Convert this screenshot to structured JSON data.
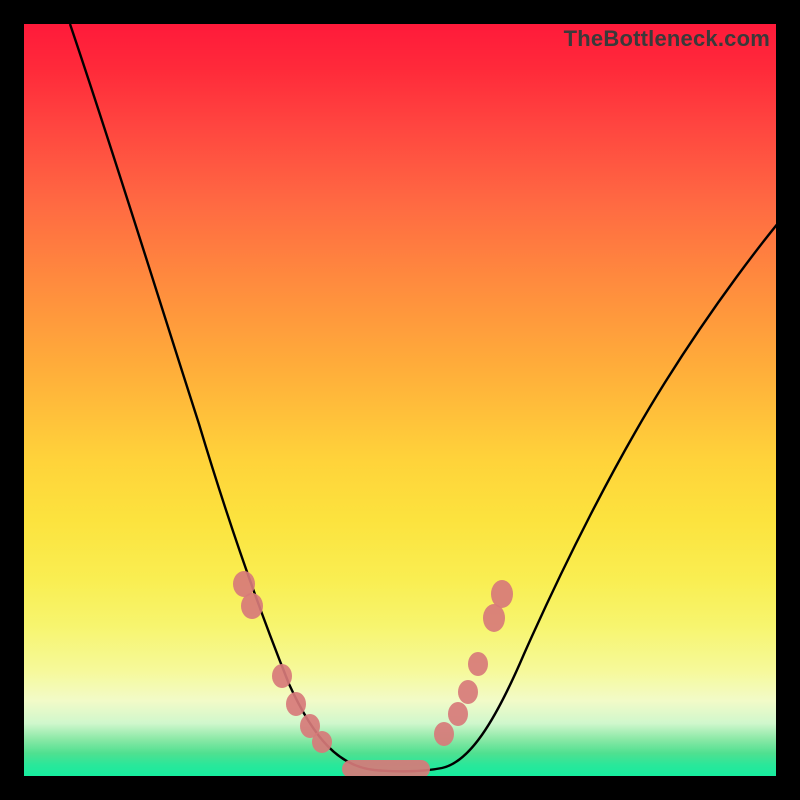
{
  "watermark": "TheBottleneck.com",
  "chart_data": {
    "type": "line",
    "title": "",
    "xlabel": "",
    "ylabel": "",
    "xlim": [
      0,
      100
    ],
    "ylim": [
      0,
      100
    ],
    "grid": false,
    "series": [
      {
        "name": "bottleneck-curve",
        "x": [
          5,
          10,
          15,
          20,
          22,
          25,
          28,
          30,
          32,
          34,
          36,
          38,
          40,
          42,
          44,
          46,
          48,
          50,
          52,
          55,
          58,
          62,
          66,
          70,
          75,
          80,
          85,
          90,
          95,
          100
        ],
        "y": [
          100,
          90,
          80,
          70,
          65,
          58,
          50,
          43,
          36,
          30,
          24,
          18,
          13,
          8,
          4,
          1,
          0,
          0,
          0,
          1,
          3,
          6,
          10,
          15,
          22,
          30,
          38,
          45,
          52,
          58
        ]
      }
    ],
    "markers": {
      "name": "highlighted-points",
      "points": [
        {
          "x": 28,
          "y": 25
        },
        {
          "x": 29,
          "y": 22
        },
        {
          "x": 33,
          "y": 13
        },
        {
          "x": 35,
          "y": 9
        },
        {
          "x": 37,
          "y": 6
        },
        {
          "x": 38,
          "y": 4.5
        },
        {
          "x": 55,
          "y": 5
        },
        {
          "x": 57,
          "y": 9
        },
        {
          "x": 58,
          "y": 13
        },
        {
          "x": 59,
          "y": 16
        },
        {
          "x": 61,
          "y": 22
        },
        {
          "x": 62,
          "y": 25
        }
      ],
      "flat_segment": {
        "x_start": 42,
        "x_end": 53,
        "y": 0.8
      }
    }
  }
}
